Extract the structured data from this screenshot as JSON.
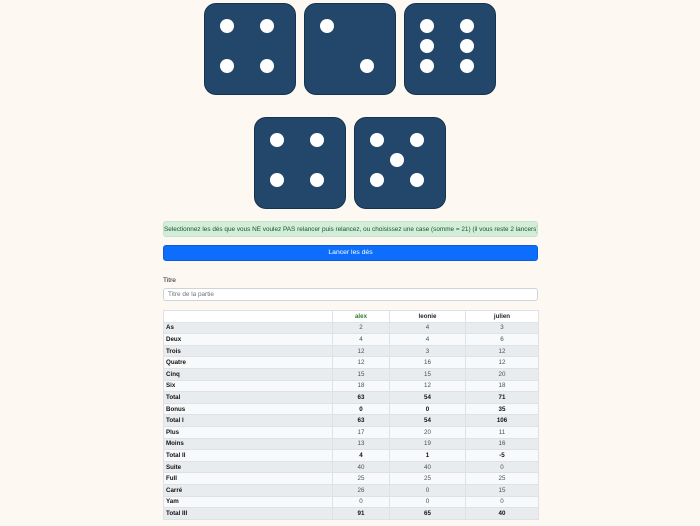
{
  "dice": [
    {
      "value": 4,
      "pips": [
        "tl",
        "tr",
        "bl",
        "br"
      ]
    },
    {
      "value": 2,
      "pips": [
        "tl",
        "br"
      ]
    },
    {
      "value": 6,
      "pips": [
        "tl",
        "tr",
        "ml",
        "mr",
        "bl",
        "br"
      ]
    },
    {
      "value": 4,
      "pips": [
        "tl",
        "tr",
        "bl",
        "br"
      ]
    },
    {
      "value": 5,
      "pips": [
        "tl",
        "tr",
        "c",
        "bl",
        "br"
      ]
    }
  ],
  "alert_text": "Selectionnez les dés que vous NE voulez PAS relancer puis relancez, ou choisissez une case (somme = 21) (il vous reste 2 lancers)",
  "roll_button": "Lancer les dés",
  "title_label": "Titre",
  "title_placeholder": "Titre de la partie",
  "players": [
    "alex",
    "leonie",
    "julien"
  ],
  "colors": {
    "die": "#23476a",
    "active_player": "#2e7d32",
    "primary": "#0d6efd",
    "alert_bg": "#d4edda"
  },
  "rows": [
    {
      "label": "As",
      "values": [
        "2",
        "4",
        "3"
      ],
      "bold": false
    },
    {
      "label": "Deux",
      "values": [
        "4",
        "4",
        "6"
      ],
      "bold": false
    },
    {
      "label": "Trois",
      "values": [
        "12",
        "3",
        "12"
      ],
      "bold": false
    },
    {
      "label": "Quatre",
      "values": [
        "12",
        "16",
        "12"
      ],
      "bold": false
    },
    {
      "label": "Cinq",
      "values": [
        "15",
        "15",
        "20"
      ],
      "bold": false
    },
    {
      "label": "Six",
      "values": [
        "18",
        "12",
        "18"
      ],
      "bold": false
    },
    {
      "label": "Total",
      "values": [
        "63",
        "54",
        "71"
      ],
      "bold": true
    },
    {
      "label": "Bonus",
      "values": [
        "0",
        "0",
        "35"
      ],
      "bold": true
    },
    {
      "label": "Total I",
      "values": [
        "63",
        "54",
        "106"
      ],
      "bold": true
    },
    {
      "label": "Plus",
      "values": [
        "17",
        "20",
        "11"
      ],
      "bold": false
    },
    {
      "label": "Moins",
      "values": [
        "13",
        "19",
        "16"
      ],
      "bold": false
    },
    {
      "label": "Total II",
      "values": [
        "4",
        "1",
        "-5"
      ],
      "bold": true
    },
    {
      "label": "Suite",
      "values": [
        "40",
        "40",
        "0"
      ],
      "bold": false
    },
    {
      "label": "Full",
      "values": [
        "25",
        "25",
        "25"
      ],
      "bold": false
    },
    {
      "label": "Carré",
      "values": [
        "26",
        "0",
        "15"
      ],
      "bold": false
    },
    {
      "label": "Yam",
      "values": [
        "0",
        "0",
        "0"
      ],
      "bold": false
    },
    {
      "label": "Total III",
      "values": [
        "91",
        "65",
        "40"
      ],
      "bold": true
    }
  ]
}
